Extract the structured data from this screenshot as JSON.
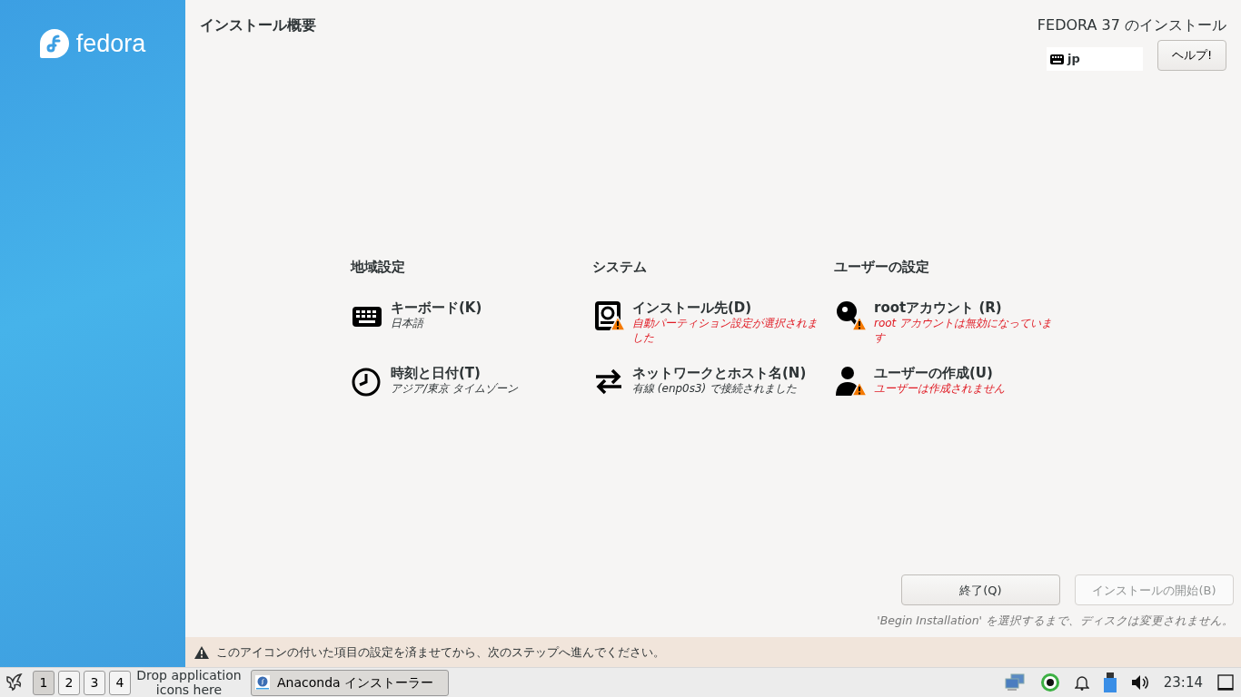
{
  "sidebar": {
    "logo_text": "fedora"
  },
  "header": {
    "title": "インストール概要",
    "product": "FEDORA 37 のインストール",
    "keyboard_layout": "jp",
    "help_button": "ヘルプ!"
  },
  "categories": [
    {
      "title": "地域設定",
      "spokes": [
        {
          "kind": "keyboard",
          "title": "キーボード(K)",
          "status": "日本語",
          "warning": false
        },
        {
          "kind": "clock",
          "title": "時刻と日付(T)",
          "status": "アジア/東京 タイムゾーン",
          "warning": false
        }
      ]
    },
    {
      "title": "システム",
      "spokes": [
        {
          "kind": "disk",
          "title": "インストール先(D)",
          "status": "自動パーティション設定が選択されました",
          "warning": true
        },
        {
          "kind": "network",
          "title": "ネットワークとホスト名(N)",
          "status": "有線 (enp0s3) で接続されました",
          "warning": false
        }
      ]
    },
    {
      "title": "ユーザーの設定",
      "spokes": [
        {
          "kind": "key",
          "title": "rootアカウント (R)",
          "status": "root アカウントは無効になっています",
          "warning": true
        },
        {
          "kind": "user",
          "title": "ユーザーの作成(U)",
          "status": "ユーザーは作成されません",
          "warning": true
        }
      ]
    }
  ],
  "buttons": [
    {
      "label": "終了(Q)",
      "disabled": false
    },
    {
      "label": "インストールの開始(B)",
      "disabled": true
    }
  ],
  "disk_note": "'Begin Installation' を選択するまで、ディスクは変更されません。",
  "warning_bar": {
    "text": "このアイコンの付いた項目の設定を済ませてから、次のステップへ進んでください。"
  },
  "taskbar": {
    "workspaces": [
      {
        "label": "1",
        "selected": true
      },
      {
        "label": "2",
        "selected": false
      },
      {
        "label": "3",
        "selected": false
      },
      {
        "label": "4",
        "selected": false
      }
    ],
    "drop_hint": "Drop application icons here",
    "task": "Anaconda インストーラー",
    "clock": "23:14"
  }
}
